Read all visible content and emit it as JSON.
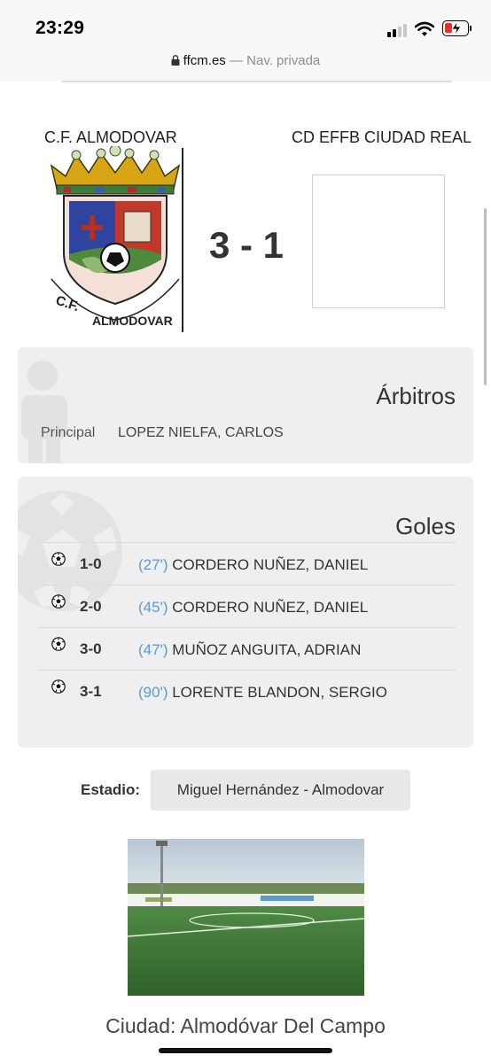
{
  "status_bar": {
    "time": "23:29"
  },
  "browser": {
    "domain": "ffcm.es",
    "separator": " — ",
    "mode": "Nav. privada"
  },
  "match": {
    "home_team": "C.F. ALMODOVAR",
    "away_team": "CD EFFB CIUDAD REAL",
    "score": "3 - 1",
    "crest_text": "C.F. ALMODOVAR"
  },
  "referees": {
    "title": "Árbitros",
    "items": [
      {
        "role": "Principal",
        "name": "LOPEZ NIELFA, CARLOS"
      }
    ]
  },
  "goals": {
    "title": "Goles",
    "items": [
      {
        "score": "1-0",
        "minute": "(27')",
        "player": "CORDERO NUÑEZ, DANIEL"
      },
      {
        "score": "2-0",
        "minute": "(45')",
        "player": "CORDERO NUÑEZ, DANIEL"
      },
      {
        "score": "3-0",
        "minute": "(47')",
        "player": "MUÑOZ ANGUITA, ADRIAN"
      },
      {
        "score": "3-1",
        "minute": "(90')",
        "player": "LORENTE BLANDON, SERGIO"
      }
    ]
  },
  "stadium": {
    "label": "Estadio:",
    "name": "Miguel Hernández - Almodovar"
  },
  "city": "Ciudad: Almodóvar Del Campo",
  "colors": {
    "panel_bg": "#efefef",
    "minute_blue": "#5b9bd5",
    "battery_red": "#e5322d"
  }
}
